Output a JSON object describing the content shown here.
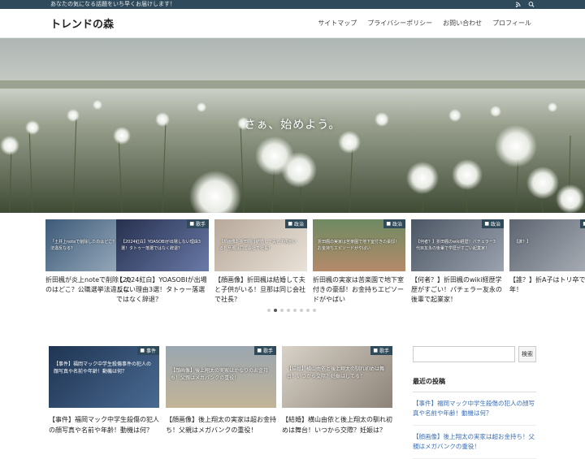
{
  "topbar": {
    "tagline": "あなたの気になる話題をいち早くお届けします！",
    "icons": [
      "rss-icon",
      "search-icon"
    ]
  },
  "header": {
    "logo": "トレンドの森",
    "nav": [
      "サイトマップ",
      "プライバシーポリシー",
      "お問い合わせ",
      "プロフィール"
    ]
  },
  "hero": {
    "catch": "さぁ、始めよう。"
  },
  "slider": {
    "slides": [
      {
        "category": "政治",
        "thumb_text": "「土井上noteで削除したのはどこ？公職選挙法違反なる？",
        "title": "折田楓が炎上noteで削除したのはどこ？公職選挙法違反に"
      },
      {
        "category": "歌手",
        "thumb_text": "【2024紅白】YOASOBIが出場しない理由3選！タトゥー落選ではなく辞退？",
        "title": "【2024紅白】YOASOBIが出場しない理由3選！タトゥー落選ではなく辞退？"
      },
      {
        "category": "政治",
        "thumb_text": "【顔画像】折田楓は結婚して夫と子供がいる！旦那は同じ会社で社長？",
        "title": "【顔画像】折田楓は結婚して夫と子供がいる！旦那は同じ会社で社長？"
      },
      {
        "category": "政治",
        "thumb_text": "折田楓の実家は苦楽園で地下室付きの豪邸！お金持ちエピソードがやばい",
        "title": "折田楓の実家は苦楽園で地下室付きの豪邸！お金持ちエピソードがやばい"
      },
      {
        "category": "政治",
        "thumb_text": "【何者？】折田楓のwiki経歴！パチェラー3代目友永の後輩で学歴がすごい起業家！",
        "title": "【何者？】折田楓のwiki経歴学歴がすごい！パチェラー友永の後輩で起業家！"
      },
      {
        "category": "政治",
        "thumb_text": "【誰？】",
        "title": "【誰？】折A子はトリ卒で同年！"
      }
    ],
    "dots_count": 8,
    "active_dot": 1
  },
  "cards": [
    {
      "category": "事件",
      "thumb_text": "【事件】福岡マック中学生殺傷事件の犯人の顔写真や名前や年齢！動機は何？",
      "title": "【事件】福岡マック中学生殺傷の犯人の顔写真や名前や年齢！動機は何？"
    },
    {
      "category": "歌手",
      "thumb_text": "【顔画像】後上翔太の実家はかなりのお金持ち！父親はメガバンクの重役！",
      "title": "【顔画像】後上翔太の実家は超お金持ち！父親はメガバンクの重役！"
    },
    {
      "category": "歌手",
      "thumb_text": "【結婚】横山由依と後上翔太の馴れ初めは舞台！いつから交際？妊娠はしてる？",
      "title": "【結婚】横山由依と後上翔太の馴れ初めは舞台！いつから交際？妊娠は？"
    }
  ],
  "sidebar": {
    "search_placeholder": "",
    "search_button": "検索",
    "recent_heading": "最近の投稿",
    "recent": [
      "【事件】福岡マック中学生殺傷の犯人の顔写真や名前や年齢！動機は何？",
      "【顔画像】後上翔太の実家は超お金持ち！父親はメガバンクの重役！"
    ]
  },
  "colors": {
    "topbar": "#2f4a5a",
    "category_badge": "#2f4a5a",
    "link": "#3b6fb6"
  }
}
